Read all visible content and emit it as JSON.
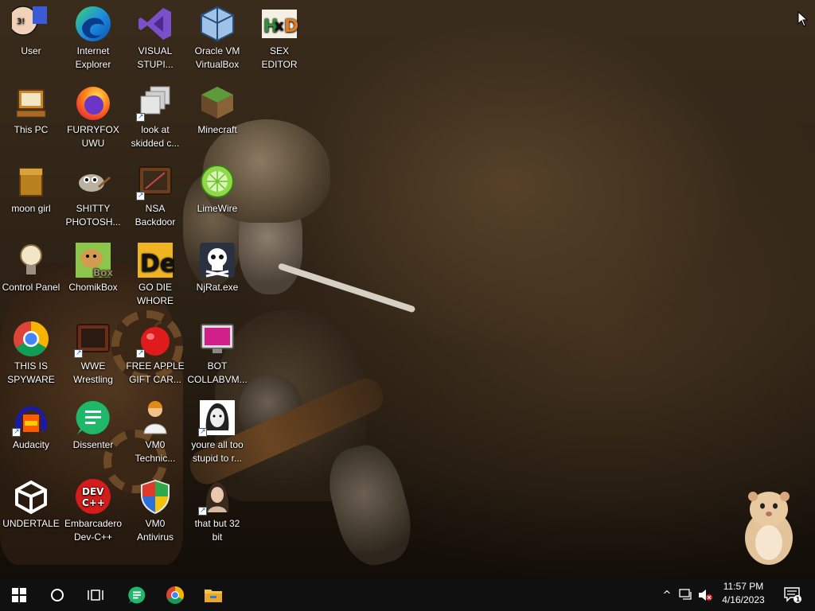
{
  "desktop": {
    "icons": [
      {
        "name": "icon-user",
        "label": "User",
        "icon": "user-face-icon"
      },
      {
        "name": "icon-internet-explorer",
        "label": "Internet\nExplorer",
        "icon": "edge-icon"
      },
      {
        "name": "icon-visual-studio",
        "label": "VISUAL\nSTUPI...",
        "icon": "visual-studio-icon"
      },
      {
        "name": "icon-virtualbox",
        "label": "Oracle VM\nVirtualBox",
        "icon": "virtualbox-icon"
      },
      {
        "name": "icon-hex-editor",
        "label": "SEX\nEDITOR",
        "icon": "hxd-icon"
      },
      {
        "name": "icon-this-pc",
        "label": "This PC",
        "icon": "computer-icon"
      },
      {
        "name": "icon-firefox",
        "label": "FURRYFOX\nUWU",
        "icon": "firefox-icon"
      },
      {
        "name": "icon-skidded",
        "label": "look at\nskidded c...",
        "icon": "stacked-windows-icon"
      },
      {
        "name": "icon-minecraft",
        "label": "Minecraft",
        "icon": "minecraft-icon"
      },
      {
        "name": "icon-moon-girl",
        "label": "moon girl",
        "icon": "wooden-box-icon"
      },
      {
        "name": "icon-gimp",
        "label": "SHITTY\nPHOTOSH...",
        "icon": "gimp-icon"
      },
      {
        "name": "icon-nsa-backdoor",
        "label": "NSA\nBackdoor",
        "icon": "retro-tv-icon"
      },
      {
        "name": "icon-limewire",
        "label": "LimeWire",
        "icon": "limewire-icon"
      },
      {
        "name": "icon-control-panel",
        "label": "Control Panel",
        "icon": "lightbulb-icon"
      },
      {
        "name": "icon-chomikbox",
        "label": "ChomikBox",
        "icon": "hamster-box-icon"
      },
      {
        "name": "icon-go-die",
        "label": "GO DIE\nWHORE",
        "icon": "de-letters-icon"
      },
      {
        "name": "icon-njrat",
        "label": "NjRat.exe",
        "icon": "skull-icon"
      },
      {
        "name": "icon-chrome",
        "label": "THIS IS\nSPYWARE",
        "icon": "chrome-icon"
      },
      {
        "name": "icon-wwe",
        "label": "WWE\nWrestling",
        "icon": "tv-screen-icon"
      },
      {
        "name": "icon-free-apple",
        "label": "FREE APPLE\nGIFT CAR...",
        "icon": "apple-icon"
      },
      {
        "name": "icon-bot-collabvm",
        "label": "BOT\nCOLLABVM...",
        "icon": "monitor-icon"
      },
      {
        "name": "icon-audacity",
        "label": "Audacity",
        "icon": "audacity-icon"
      },
      {
        "name": "icon-dissenter",
        "label": "Dissenter",
        "icon": "dissenter-icon"
      },
      {
        "name": "icon-vm0-technic",
        "label": "VM0\nTechnic...",
        "icon": "technician-icon"
      },
      {
        "name": "icon-stupid",
        "label": "youre all too\nstupid to r...",
        "icon": "portrait-icon"
      },
      {
        "name": "icon-undertale",
        "label": "UNDERTALE",
        "icon": "unity-icon"
      },
      {
        "name": "icon-devcpp",
        "label": "Embarcadero\nDev-C++",
        "icon": "devcpp-icon"
      },
      {
        "name": "icon-vm0-antivirus",
        "label": "VM0\nAntivirus",
        "icon": "shield-icon"
      },
      {
        "name": "icon-32bit",
        "label": "that but 32\nbit",
        "icon": "portrait-woman-icon"
      }
    ],
    "devcpp_badge": "DEV\nC++",
    "chomik_badge": "Box",
    "go_die_badge": "De",
    "hxd_badge": "HxD",
    "user_badge": "3!"
  },
  "taskbar": {
    "start": "windows-logo-icon",
    "search": "search-circle-icon",
    "task_view": "task-view-icon",
    "pinned": [
      "dissenter-icon",
      "chrome-icon",
      "file-explorer-icon"
    ],
    "tray": {
      "chevron": "^",
      "network": "network-icon",
      "volume": "volume-muted-icon",
      "notifications_count": "1"
    },
    "clock": {
      "time": "11:57 PM",
      "date": "4/16/2023"
    }
  }
}
